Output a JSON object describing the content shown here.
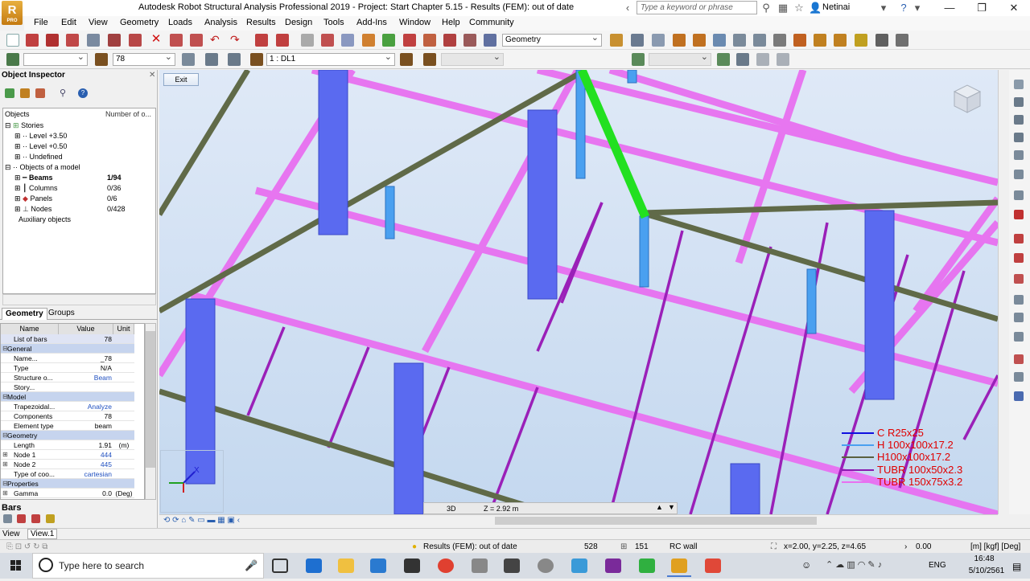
{
  "titlebar": {
    "title": "Autodesk Robot Structural Analysis Professional 2019 - Project: Start Chapter 5.15 - Results (FEM): out of date",
    "logo_text": "R",
    "logo_sub": "PRO",
    "search_placeholder": "Type a keyword or phrase",
    "user": "Netinai"
  },
  "menu": [
    "File",
    "Edit",
    "View",
    "Geometry",
    "Loads",
    "Analysis",
    "Results",
    "Design",
    "Tools",
    "Add-Ins",
    "Window",
    "Help",
    "Community"
  ],
  "toolbar": {
    "layout_combo": "Geometry",
    "bar_number": "78",
    "load_case": "1 : DL1"
  },
  "object_inspector": {
    "title": "Object Inspector",
    "col_objects": "Objects",
    "col_number": "Number of o...",
    "tree": [
      {
        "label": "Stories",
        "count": ""
      },
      {
        "label": "Level +3.50",
        "count": ""
      },
      {
        "label": "Level +0.50",
        "count": ""
      },
      {
        "label": "Undefined",
        "count": ""
      },
      {
        "label": "Objects of a model",
        "count": ""
      },
      {
        "label": "Beams",
        "count": "1/94"
      },
      {
        "label": "Columns",
        "count": "0/36"
      },
      {
        "label": "Panels",
        "count": "0/6"
      },
      {
        "label": "Nodes",
        "count": "0/428"
      },
      {
        "label": "Auxiliary objects",
        "count": ""
      }
    ],
    "tabs": [
      "Geometry",
      "Groups"
    ],
    "prop_headers": {
      "name": "Name",
      "value": "Value",
      "unit": "Unit"
    },
    "properties": [
      {
        "name": "List of bars",
        "value": "78",
        "unit": "",
        "kind": "lavender"
      },
      {
        "name": "General",
        "value": "",
        "unit": "",
        "kind": "section"
      },
      {
        "name": "Name...",
        "value": "_78",
        "unit": "",
        "kind": "plain"
      },
      {
        "name": "Type",
        "value": "N/A",
        "unit": "",
        "kind": "plain"
      },
      {
        "name": "Structure o...",
        "value": "Beam",
        "unit": "",
        "kind": "blue"
      },
      {
        "name": "Story...",
        "value": "",
        "unit": "",
        "kind": "blue"
      },
      {
        "name": "Model",
        "value": "",
        "unit": "",
        "kind": "section"
      },
      {
        "name": "Trapezoidal...",
        "value": "Analyze",
        "unit": "",
        "kind": "blue"
      },
      {
        "name": "Components",
        "value": "78",
        "unit": "",
        "kind": "plain"
      },
      {
        "name": "Element type",
        "value": "beam",
        "unit": "",
        "kind": "plain"
      },
      {
        "name": "Geometry",
        "value": "",
        "unit": "",
        "kind": "section"
      },
      {
        "name": "Length",
        "value": "1.91",
        "unit": "(m)",
        "kind": "plain"
      },
      {
        "name": "Node 1",
        "value": "444",
        "unit": "",
        "kind": "blue"
      },
      {
        "name": "Node 2",
        "value": "445",
        "unit": "",
        "kind": "blue"
      },
      {
        "name": "Type of coo...",
        "value": "cartesian",
        "unit": "",
        "kind": "blue"
      },
      {
        "name": "Properties",
        "value": "",
        "unit": "",
        "kind": "section"
      },
      {
        "name": "Gamma",
        "value": "0.0",
        "unit": "(Deg)",
        "kind": "plain"
      }
    ],
    "bars_label": "Bars"
  },
  "viewport": {
    "exit_label": "Exit",
    "view_mode": "3D",
    "z_level": "Z = 2.92 m",
    "legend": [
      {
        "label": "C R25x25",
        "color": "#1010e0"
      },
      {
        "label": "H 100x100x17.2",
        "color": "#4aa0f0"
      },
      {
        "label": "H100x100x17.2",
        "color": "#5a6040"
      },
      {
        "label": "TUBR 100x50x2.3",
        "color": "#8a1ab0"
      },
      {
        "label": "TUBR 150x75x3.2",
        "color": "#e870f0"
      }
    ]
  },
  "bottom_tabs": [
    "View",
    "View.1"
  ],
  "statusbar": {
    "results_status": "Results (FEM): out of date",
    "nodes_count": "528",
    "bars_count": "151",
    "section": "RC wall",
    "coords": "x=2.00, y=2.25, z=4.65",
    "value": "0.00",
    "units": "[m] [kgf] [Deg]"
  },
  "taskbar": {
    "search_placeholder": "Type here to search",
    "language": "ENG",
    "time": "16:48",
    "date": "5/10/2561"
  }
}
